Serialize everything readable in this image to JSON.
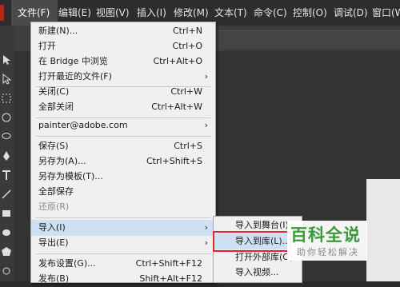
{
  "menubar": {
    "items": [
      {
        "label": "文件(F)",
        "active": true
      },
      {
        "label": "编辑(E)"
      },
      {
        "label": "视图(V)"
      },
      {
        "label": "插入(I)"
      },
      {
        "label": "修改(M)"
      },
      {
        "label": "文本(T)"
      },
      {
        "label": "命令(C)"
      },
      {
        "label": "控制(O)"
      },
      {
        "label": "调试(D)"
      },
      {
        "label": "窗口(W)"
      }
    ]
  },
  "file_menu": {
    "items": [
      {
        "label": "新建(N)...",
        "shortcut": "Ctrl+N"
      },
      {
        "label": "打开",
        "shortcut": "Ctrl+O"
      },
      {
        "label": "在 Bridge 中浏览",
        "shortcut": "Ctrl+Alt+O"
      },
      {
        "label": "打开最近的文件(F)",
        "arrow": "›"
      },
      {
        "label": "关闭(C)",
        "shortcut": "Ctrl+W"
      },
      {
        "label": "全部关闭",
        "shortcut": "Ctrl+Alt+W"
      },
      {
        "label": "painter@adobe.com",
        "arrow": "›"
      },
      {
        "label": "保存(S)",
        "shortcut": "Ctrl+S"
      },
      {
        "label": "另存为(A)...",
        "shortcut": "Ctrl+Shift+S"
      },
      {
        "label": "另存为模板(T)..."
      },
      {
        "label": "全部保存"
      },
      {
        "label": "还原(R)",
        "disabled": true
      },
      {
        "label": "导入(I)",
        "arrow": "›",
        "highlighted": true
      },
      {
        "label": "导出(E)",
        "arrow": "›"
      },
      {
        "label": "发布设置(G)...",
        "shortcut": "Ctrl+Shift+F12"
      },
      {
        "label": "发布(B)",
        "shortcut": "Shift+Alt+F12"
      }
    ]
  },
  "import_submenu": {
    "items": [
      {
        "label": "导入到舞台(I)..."
      },
      {
        "label": "导入到库(L)...",
        "selected": true
      },
      {
        "label": "打开外部库(O)..."
      },
      {
        "label": "导入视频..."
      }
    ]
  },
  "watermark": {
    "title": "百科全说",
    "subtitle": "助你轻松解决"
  },
  "colors": {
    "highlight": "#cfe0f5",
    "callout": "#e5232a",
    "watermark": "#3a9a3a"
  }
}
